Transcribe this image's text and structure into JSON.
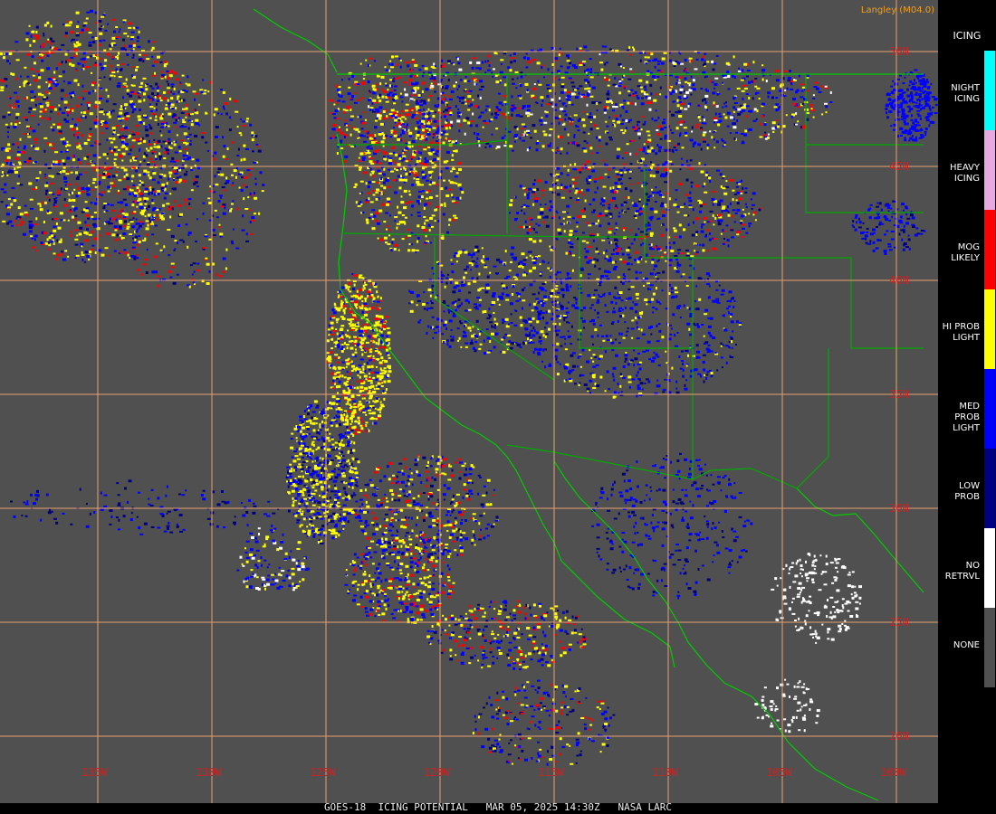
{
  "title": "GOES-18  ICING POTENTIAL   MAR 05, 2025 14:30Z   NASA LARC",
  "credit": "Langley (M04.0)",
  "legend": {
    "title": "ICING",
    "items": [
      {
        "label": "NIGHT\nICING",
        "color": "#00ffff"
      },
      {
        "label": "HEAVY\nICING",
        "color": "#e8a8e0"
      },
      {
        "label": "MOG\nLIKELY",
        "color": "#ff0000"
      },
      {
        "label": "HI PROB\nLIGHT",
        "color": "#ffff00"
      },
      {
        "label": "MED PROB\nLIGHT",
        "color": "#0000ff"
      },
      {
        "label": "LOW\nPROB",
        "color": "#000080"
      },
      {
        "label": "NO\nRETRVL",
        "color": "#ffffff"
      },
      {
        "label": "NONE",
        "color": "#505050"
      }
    ]
  },
  "grid": {
    "latitudes": [
      "50N",
      "45N",
      "40N",
      "35N",
      "30N",
      "25N",
      "20N"
    ],
    "longitudes": [
      "135W",
      "130W",
      "125W",
      "120W",
      "115W",
      "110W",
      "105W",
      "100W"
    ]
  },
  "colors": {
    "background": "#505050",
    "grid": "#e8a070",
    "coastline": "#00cc00",
    "borders": "#00aa00"
  }
}
